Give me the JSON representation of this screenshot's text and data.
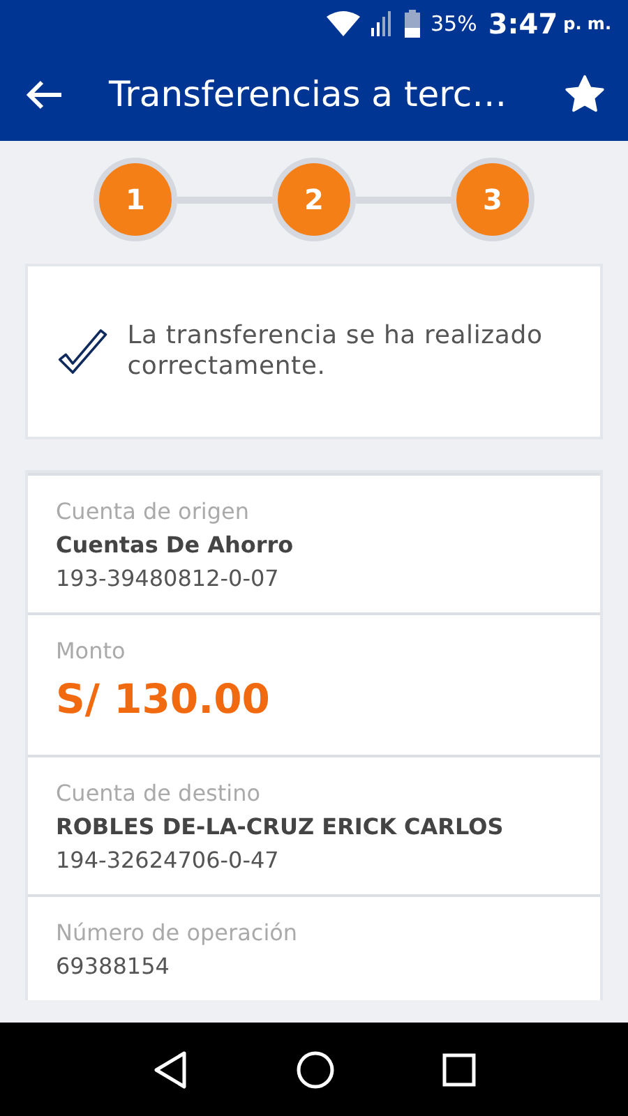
{
  "status_bar": {
    "battery": "35%",
    "time": "3:47",
    "period": "p. m."
  },
  "app_bar": {
    "title": "Transferencias a terc…"
  },
  "steps": [
    {
      "label": "1",
      "completed": true
    },
    {
      "label": "2",
      "completed": true
    },
    {
      "label": "3",
      "completed": true
    }
  ],
  "confirmation": {
    "message": "La transferencia se ha realizado correctamente."
  },
  "details": [
    {
      "kind": "account",
      "label": "Cuenta de origen",
      "primary": "Cuentas De Ahorro",
      "secondary": "193-39480812-0-07"
    },
    {
      "kind": "amount",
      "label": "Monto",
      "primary": "S/ 130.00"
    },
    {
      "kind": "account",
      "label": "Cuenta de destino",
      "primary": "ROBLES DE-LA-CRUZ ERICK CARLOS",
      "secondary": "194-32624706-0-47"
    },
    {
      "kind": "plain",
      "label": "Número de operación",
      "primary": "69388154"
    }
  ]
}
